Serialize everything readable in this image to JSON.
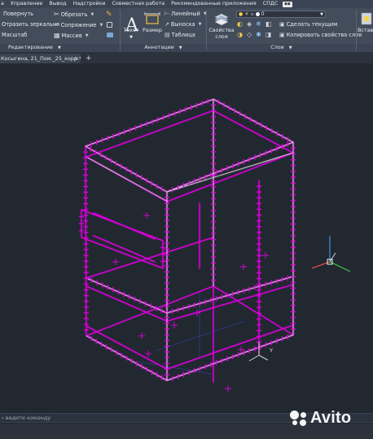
{
  "menu": {
    "items": [
      {
        "label": "а"
      },
      {
        "label": "Управление"
      },
      {
        "label": "Вывод"
      },
      {
        "label": "Надстройки"
      },
      {
        "label": "Совместная работа"
      },
      {
        "label": "Рекомендованные приложения"
      },
      {
        "label": "СПДС"
      }
    ],
    "badge": "▪▪"
  },
  "ribbon": {
    "modify": {
      "rotate": "Повернуть",
      "mirror": "Отразить зеркально",
      "scale": "Масштаб",
      "trim": "Обрезать",
      "fillet": "Сопряжение",
      "array": "Массив",
      "footer": "Редактирование"
    },
    "annotation": {
      "text": "Текст",
      "dimension": "Размер",
      "linear": "Линейный",
      "leader": "Выноска",
      "table": "Таблица",
      "footer": "Аннотации"
    },
    "layers": {
      "properties_line1": "Свойства",
      "properties_line2": "слоя",
      "current_layer": "0",
      "make_current": "Сделать текущим",
      "match_layer": "Копировать свойства слоя",
      "footer": "Слои"
    },
    "insert": "Вставк"
  },
  "tabs": {
    "file": "Косыгина, 21_Пом._25_корр.*",
    "close": "×",
    "add": "+"
  },
  "drawing": {
    "ucs_label": "Y"
  },
  "commandline": {
    "prompt": "ведите команду"
  },
  "watermark": {
    "brand": "Avito"
  },
  "colors": {
    "accent": "#d400d4",
    "background": "#212830",
    "ribbon": "#434c5b"
  }
}
